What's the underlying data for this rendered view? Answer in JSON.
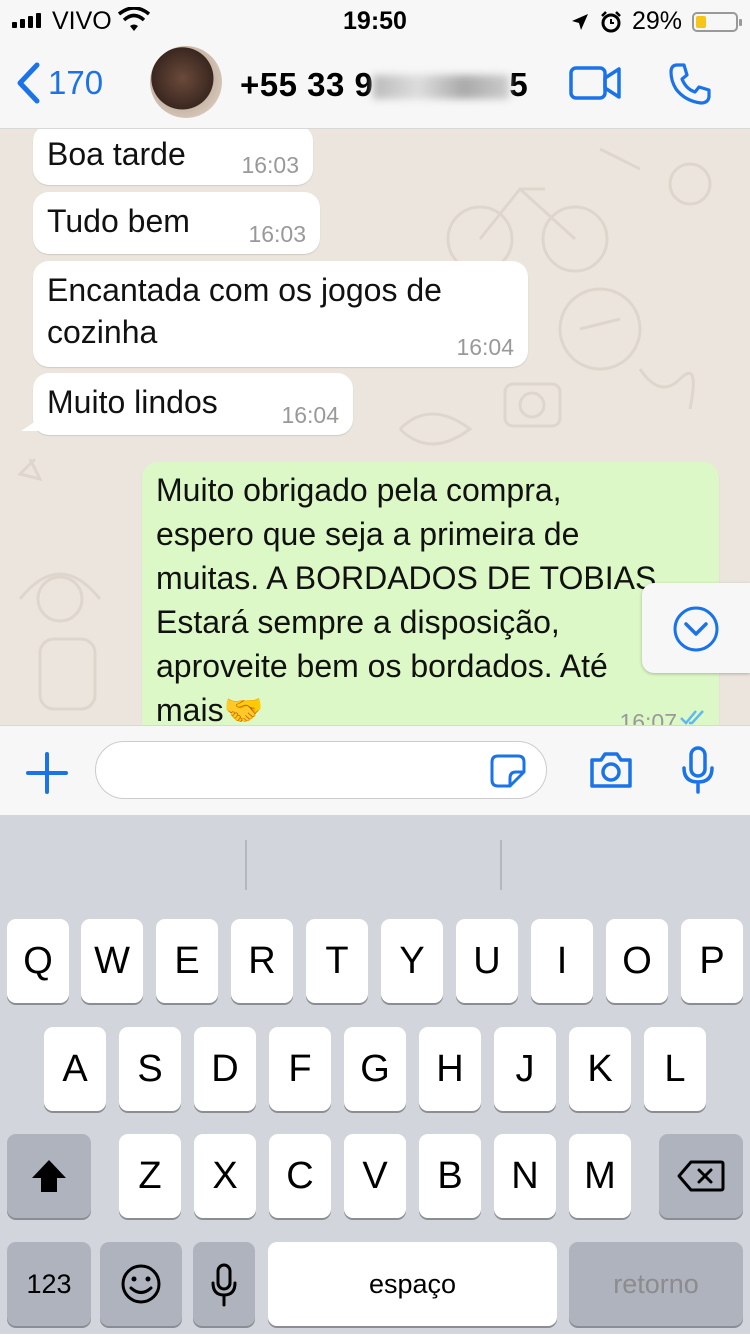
{
  "status_bar": {
    "carrier": "VIVO",
    "time": "19:50",
    "battery_text": "29%"
  },
  "header": {
    "back_count": "170",
    "contact_visible_prefix": "+55 33 9",
    "contact_visible_suffix": "5"
  },
  "messages": [
    {
      "direction": "in",
      "text": "Boa tarde",
      "time": "16:03"
    },
    {
      "direction": "in",
      "text": "Tudo bem",
      "time": "16:03"
    },
    {
      "direction": "in",
      "line1": "Encantada com os jogos de",
      "line2": "cozinha",
      "time": "16:04"
    },
    {
      "direction": "in",
      "text": "Muito lindos",
      "time": "16:04"
    },
    {
      "direction": "out",
      "lines": [
        "Muito obrigado pela compra,",
        "espero que seja a primeira de",
        "muitas. A BORDADOS DE TOBIAS",
        "Estará sempre a disposição,",
        "aproveite bem os bordados. Até",
        "mais🤝"
      ],
      "time": "16:07"
    }
  ],
  "input": {
    "placeholder": ""
  },
  "keyboard": {
    "row1": [
      "Q",
      "W",
      "E",
      "R",
      "T",
      "Y",
      "U",
      "I",
      "O",
      "P"
    ],
    "row2": [
      "A",
      "S",
      "D",
      "F",
      "G",
      "H",
      "J",
      "K",
      "L"
    ],
    "row3": [
      "Z",
      "X",
      "C",
      "V",
      "B",
      "N",
      "M"
    ],
    "numbers_label": "123",
    "space_label": "espaço",
    "return_label": "retorno"
  },
  "colors": {
    "accent": "#1a73e8",
    "outgoing_bubble": "#dcf8c6",
    "chat_bg": "#ece5dd"
  }
}
